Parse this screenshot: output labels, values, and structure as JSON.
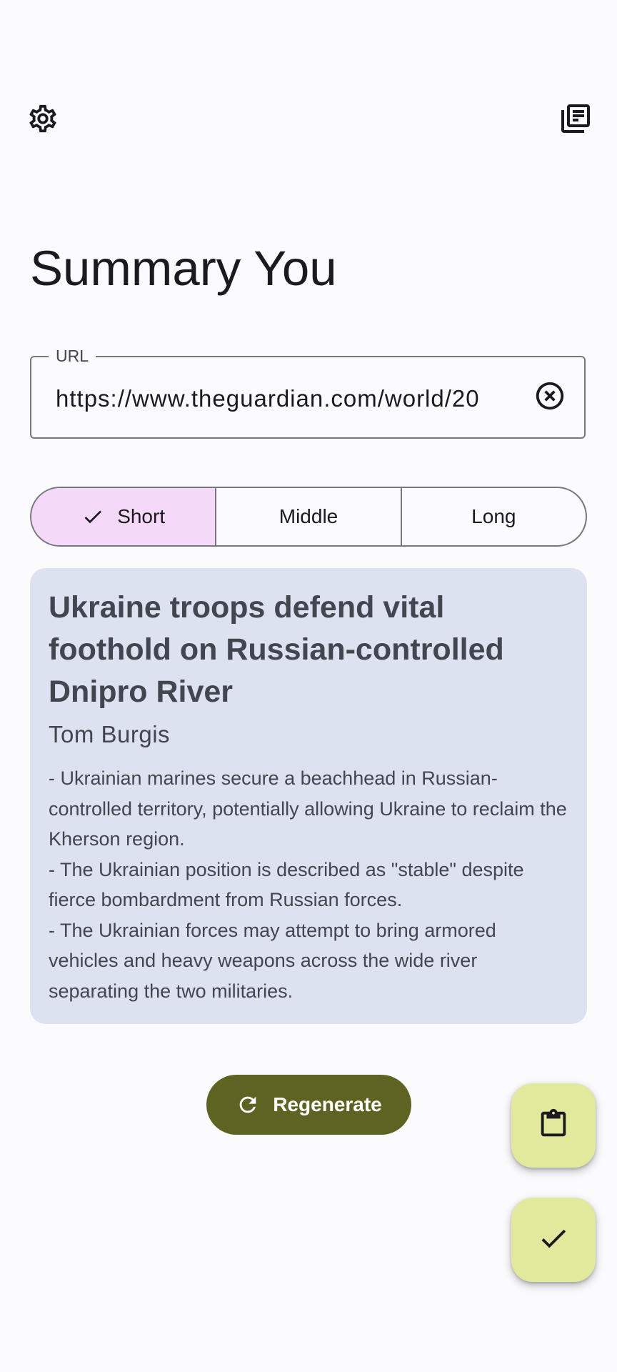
{
  "header": {
    "settings_icon": "gear-icon",
    "library_icon": "library-books-icon"
  },
  "app": {
    "title": "Summary You"
  },
  "url_field": {
    "label": "URL",
    "value": "https://www.theguardian.com/world/20",
    "clear_icon": "clear-circle-icon"
  },
  "length_selector": {
    "options": [
      {
        "label": "Short",
        "selected": true
      },
      {
        "label": "Middle",
        "selected": false
      },
      {
        "label": "Long",
        "selected": false
      }
    ],
    "selected_color": "#f5d9f8"
  },
  "summary": {
    "title": "Ukraine troops defend vital foothold on Russian-controlled Dnipro River",
    "author": "Tom Burgis",
    "points": [
      "- Ukrainian marines secure a beachhead in Russian-controlled territory, potentially allowing Ukraine to reclaim the Kherson region.",
      "- The Ukrainian position is described as \"stable\" despite fierce bombardment from Russian forces.",
      "- The Ukrainian forces may attempt to bring armored vehicles and heavy weapons across the wide river separating the two militaries."
    ],
    "background_color": "#dde2f0"
  },
  "actions": {
    "regenerate_label": "Regenerate",
    "regenerate_icon": "refresh-icon",
    "regenerate_color": "#5f6322",
    "clipboard_icon": "clipboard-icon",
    "done_icon": "check-icon",
    "fab_color": "#e2e89c"
  }
}
